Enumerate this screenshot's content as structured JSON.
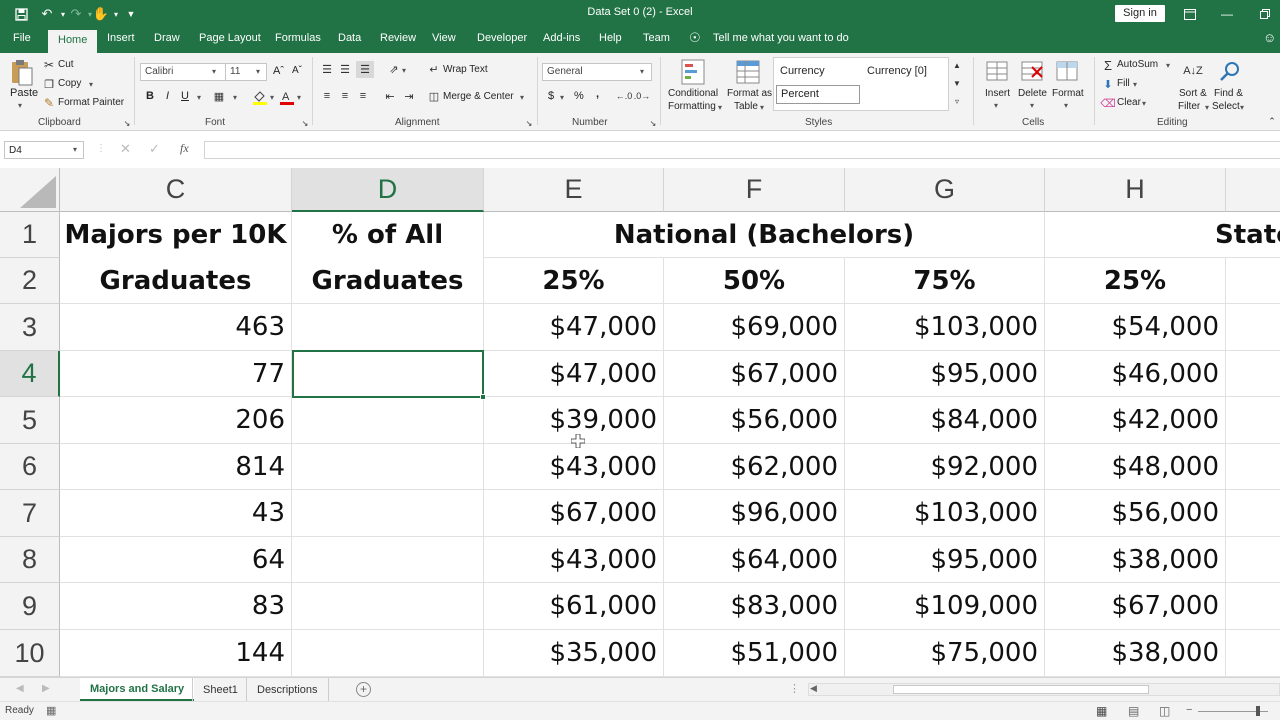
{
  "titlebar": {
    "document_title": "Data Set 0 (2)  -  Excel",
    "signin_label": "Sign in",
    "qat_icons": [
      "save-icon",
      "undo-icon",
      "redo-icon",
      "touch-mode-icon",
      "customize-qat-icon"
    ]
  },
  "ribbon_tabs": [
    "File",
    "Home",
    "Insert",
    "Draw",
    "Page Layout",
    "Formulas",
    "Data",
    "Review",
    "View",
    "Developer",
    "Add-ins",
    "Help",
    "Team"
  ],
  "active_tab": "Home",
  "tell_me": "Tell me what you want to do",
  "clipboard": {
    "paste": "Paste",
    "cut": "Cut",
    "copy": "Copy",
    "format_painter": "Format Painter",
    "label": "Clipboard"
  },
  "font": {
    "name": "Calibri",
    "size": "11",
    "bold": "B",
    "italic": "I",
    "underline": "U",
    "label": "Font"
  },
  "alignment": {
    "wrap_text": "Wrap Text",
    "merge_center": "Merge & Center",
    "label": "Alignment"
  },
  "number": {
    "format": "General",
    "currency_symbol": "$",
    "percent_symbol": "%",
    "comma": ",",
    "label": "Number"
  },
  "styles": {
    "conditional_1": "Conditional",
    "conditional_2": "Formatting",
    "format_table_1": "Format as",
    "format_table_2": "Table",
    "currency": "Currency",
    "currency0": "Currency [0]",
    "percent": "Percent",
    "label": "Styles"
  },
  "cells": {
    "insert": "Insert",
    "delete": "Delete",
    "format": "Format",
    "label": "Cells"
  },
  "editing": {
    "autosum": "AutoSum",
    "fill": "Fill",
    "clear": "Clear",
    "sort_1": "Sort &",
    "sort_2": "Filter",
    "find_1": "Find &",
    "find_2": "Select",
    "label": "Editing"
  },
  "formula_bar": {
    "name_box": "D4",
    "value": ""
  },
  "grid": {
    "columns": [
      "C",
      "D",
      "E",
      "F",
      "G",
      "H"
    ],
    "selected_column": "D",
    "rows": [
      "1",
      "2",
      "3",
      "4",
      "5",
      "6",
      "7",
      "8",
      "9",
      "10"
    ],
    "selected_row": "4",
    "header_row1": {
      "c": "Majors per 10K",
      "d": "% of All",
      "national": "National (Bachelors)",
      "state": "State"
    },
    "header_row2": {
      "c": "Graduates",
      "d": "Graduates",
      "e": "25%",
      "f": "50%",
      "g": "75%",
      "h": "25%"
    },
    "data_rows": [
      {
        "c": "463",
        "d": "",
        "e": "$47,000",
        "f": "$69,000",
        "g": "$103,000",
        "h": "$54,000"
      },
      {
        "c": "77",
        "d": "",
        "e": "$47,000",
        "f": "$67,000",
        "g": "$95,000",
        "h": "$46,000"
      },
      {
        "c": "206",
        "d": "",
        "e": "$39,000",
        "f": "$56,000",
        "g": "$84,000",
        "h": "$42,000"
      },
      {
        "c": "814",
        "d": "",
        "e": "$43,000",
        "f": "$62,000",
        "g": "$92,000",
        "h": "$48,000"
      },
      {
        "c": "43",
        "d": "",
        "e": "$67,000",
        "f": "$96,000",
        "g": "$103,000",
        "h": "$56,000"
      },
      {
        "c": "64",
        "d": "",
        "e": "$43,000",
        "f": "$64,000",
        "g": "$95,000",
        "h": "$38,000"
      },
      {
        "c": "83",
        "d": "",
        "e": "$61,000",
        "f": "$83,000",
        "g": "$109,000",
        "h": "$67,000"
      },
      {
        "c": "144",
        "d": "",
        "e": "$35,000",
        "f": "$51,000",
        "g": "$75,000",
        "h": "$38,000"
      }
    ]
  },
  "sheet_tabs": [
    "Majors and Salary",
    "Sheet1",
    "Descriptions"
  ],
  "active_sheet": "Majors and Salary",
  "status": {
    "ready": "Ready"
  },
  "colors": {
    "accent": "#217346",
    "ribbon_bg": "#f3f3f3",
    "grid_line": "#e1e1e1"
  }
}
